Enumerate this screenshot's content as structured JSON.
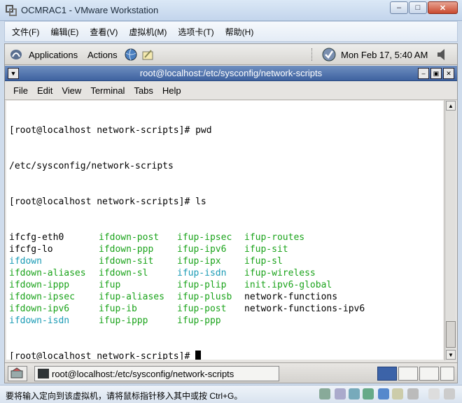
{
  "window": {
    "title": "OCMRAC1 - VMware Workstation",
    "controls": [
      "minimize",
      "maximize",
      "close"
    ]
  },
  "vm_menu": [
    "文件(F)",
    "编辑(E)",
    "查看(V)",
    "虚拟机(M)",
    "选项卡(T)",
    "帮助(H)"
  ],
  "gnome_panel": {
    "applications": "Applications",
    "actions": "Actions",
    "clock": "Mon Feb 17,  5:40 AM"
  },
  "terminal": {
    "title": "root@localhost:/etc/sysconfig/network-scripts",
    "menu": [
      "File",
      "Edit",
      "View",
      "Terminal",
      "Tabs",
      "Help"
    ],
    "lines": [
      "[root@localhost network-scripts]# pwd",
      "/etc/sysconfig/network-scripts",
      "[root@localhost network-scripts]# ls"
    ],
    "ls_rows": [
      [
        {
          "t": "ifcfg-eth0",
          "c": "#000000"
        },
        {
          "t": "ifdown-post",
          "c": "#1aa31a"
        },
        {
          "t": "ifup-ipsec",
          "c": "#1aa31a"
        },
        {
          "t": "ifup-routes",
          "c": "#1aa31a"
        }
      ],
      [
        {
          "t": "ifcfg-lo",
          "c": "#000000"
        },
        {
          "t": "ifdown-ppp",
          "c": "#1aa31a"
        },
        {
          "t": "ifup-ipv6",
          "c": "#1aa31a"
        },
        {
          "t": "ifup-sit",
          "c": "#1aa31a"
        }
      ],
      [
        {
          "t": "ifdown",
          "c": "#1a9bb5"
        },
        {
          "t": "ifdown-sit",
          "c": "#1aa31a"
        },
        {
          "t": "ifup-ipx",
          "c": "#1aa31a"
        },
        {
          "t": "ifup-sl",
          "c": "#1aa31a"
        }
      ],
      [
        {
          "t": "ifdown-aliases",
          "c": "#1aa31a"
        },
        {
          "t": "ifdown-sl",
          "c": "#1aa31a"
        },
        {
          "t": "ifup-isdn",
          "c": "#1a9bb5"
        },
        {
          "t": "ifup-wireless",
          "c": "#1aa31a"
        }
      ],
      [
        {
          "t": "ifdown-ippp",
          "c": "#1aa31a"
        },
        {
          "t": "ifup",
          "c": "#1aa31a"
        },
        {
          "t": "ifup-plip",
          "c": "#1aa31a"
        },
        {
          "t": "init.ipv6-global",
          "c": "#1aa31a"
        }
      ],
      [
        {
          "t": "ifdown-ipsec",
          "c": "#1aa31a"
        },
        {
          "t": "ifup-aliases",
          "c": "#1aa31a"
        },
        {
          "t": "ifup-plusb",
          "c": "#1aa31a"
        },
        {
          "t": "network-functions",
          "c": "#000000"
        }
      ],
      [
        {
          "t": "ifdown-ipv6",
          "c": "#1aa31a"
        },
        {
          "t": "ifup-ib",
          "c": "#1aa31a"
        },
        {
          "t": "ifup-post",
          "c": "#1aa31a"
        },
        {
          "t": "network-functions-ipv6",
          "c": "#000000"
        }
      ],
      [
        {
          "t": "ifdown-isdn",
          "c": "#1a9bb5"
        },
        {
          "t": "ifup-ippp",
          "c": "#1aa31a"
        },
        {
          "t": "ifup-ppp",
          "c": "#1aa31a"
        },
        {
          "t": "",
          "c": "#000000"
        }
      ]
    ],
    "prompt": "[root@localhost network-scripts]# "
  },
  "taskbar": {
    "task_label": "root@localhost:/etc/sysconfig/network-scripts"
  },
  "statusbar": {
    "message": "要将输入定向到该虚拟机，请将鼠标指针移入其中或按 Ctrl+G。"
  }
}
